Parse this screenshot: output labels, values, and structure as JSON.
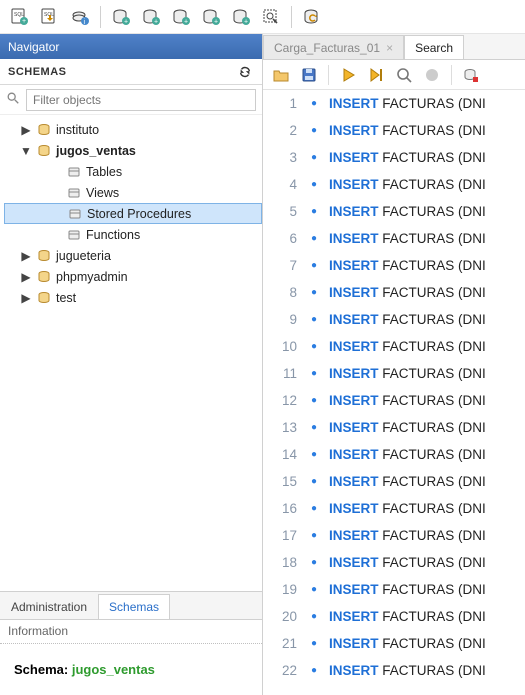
{
  "toolbar_icons": [
    "sql-new-icon",
    "sql-open-icon",
    "info-icon",
    "db-add-icon",
    "table-add-icon",
    "table-edit-icon",
    "column-add-icon",
    "proc-add-icon",
    "search-db-icon",
    "db-refresh-icon"
  ],
  "navigator": {
    "title": "Navigator"
  },
  "schemas_header": "SCHEMAS",
  "filter": {
    "placeholder": "Filter objects"
  },
  "tree": {
    "items": [
      {
        "expand": "closed",
        "icon": "database-icon",
        "indent": 1,
        "label": "instituto",
        "bold": false,
        "selected": false
      },
      {
        "expand": "open",
        "icon": "database-icon",
        "indent": 1,
        "label": "jugos_ventas",
        "bold": true,
        "selected": false
      },
      {
        "expand": "none",
        "icon": "folder-table-icon",
        "indent": 2,
        "label": "Tables",
        "bold": false,
        "selected": false
      },
      {
        "expand": "none",
        "icon": "folder-view-icon",
        "indent": 2,
        "label": "Views",
        "bold": false,
        "selected": false
      },
      {
        "expand": "none",
        "icon": "folder-proc-icon",
        "indent": 2,
        "label": "Stored Procedures",
        "bold": false,
        "selected": true
      },
      {
        "expand": "none",
        "icon": "folder-func-icon",
        "indent": 2,
        "label": "Functions",
        "bold": false,
        "selected": false
      },
      {
        "expand": "closed",
        "icon": "database-icon",
        "indent": 1,
        "label": "jugueteria",
        "bold": false,
        "selected": false
      },
      {
        "expand": "closed",
        "icon": "database-icon",
        "indent": 1,
        "label": "phpmyadmin",
        "bold": false,
        "selected": false
      },
      {
        "expand": "closed",
        "icon": "database-icon",
        "indent": 1,
        "label": "test",
        "bold": false,
        "selected": false
      }
    ]
  },
  "bottom_tabs": {
    "admin": "Administration",
    "schemas": "Schemas",
    "active": "schemas"
  },
  "info": {
    "header": "Information",
    "label": "Schema:",
    "value": "jugos_ventas"
  },
  "editor_tabs": {
    "file": "Carga_Facturas_01",
    "search": "Search"
  },
  "editor_toolbar_icons": [
    "open-file-icon",
    "save-icon",
    "run-icon",
    "run-current-icon",
    "explain-icon",
    "stop-icon",
    "reconnect-icon"
  ],
  "code": {
    "line_count": 22,
    "keyword": "INSERT",
    "rest": " FACTURAS (DNI"
  }
}
